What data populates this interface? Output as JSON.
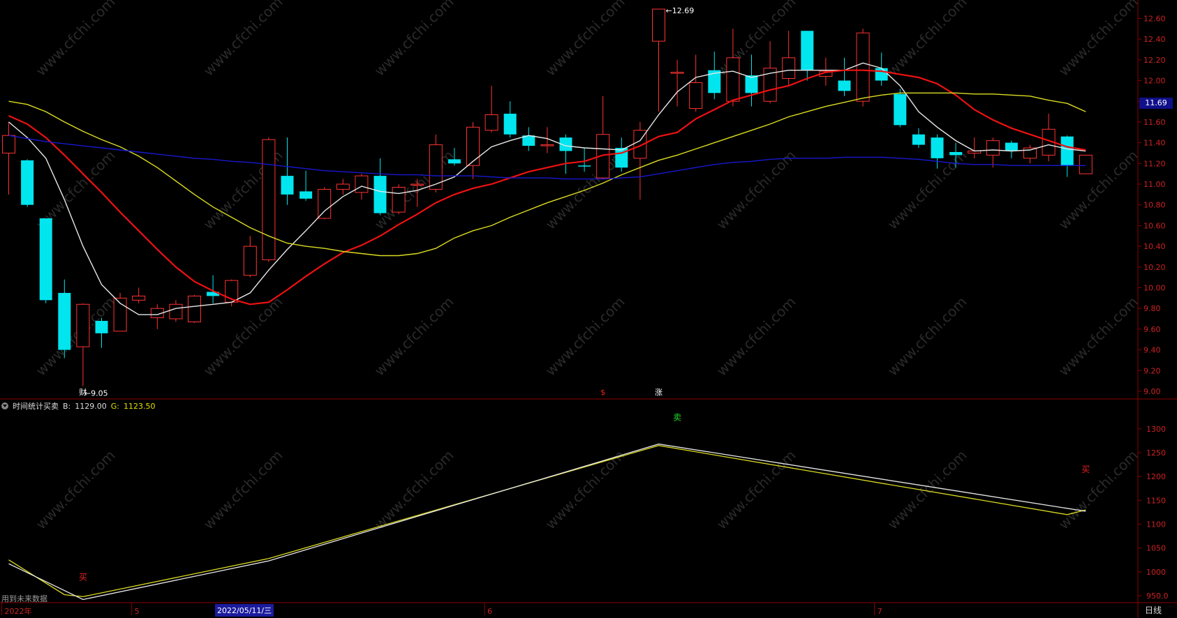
{
  "chart_data": {
    "type": "candlestick",
    "price_axis": {
      "ticks": [
        "9.00",
        "9.20",
        "9.40",
        "9.60",
        "9.80",
        "10.00",
        "10.20",
        "10.40",
        "10.60",
        "10.80",
        "11.00",
        "11.20",
        "11.40",
        "11.60",
        "11.80",
        "12.00",
        "12.20",
        "12.40",
        "12.60"
      ],
      "ylim": [
        8.93,
        12.78
      ]
    },
    "candles": [
      [
        11.3,
        11.47,
        11.6,
        10.9
      ],
      [
        11.23,
        10.8,
        11.24,
        10.78
      ],
      [
        10.67,
        9.88,
        10.67,
        9.85
      ],
      [
        9.95,
        9.4,
        10.08,
        9.32
      ],
      [
        9.43,
        9.84,
        9.85,
        9.05
      ],
      [
        9.68,
        9.56,
        9.71,
        9.42
      ],
      [
        9.58,
        9.9,
        9.95,
        9.58
      ],
      [
        9.88,
        9.92,
        10.0,
        9.85
      ],
      [
        9.71,
        9.8,
        9.84,
        9.6
      ],
      [
        9.7,
        9.84,
        9.88,
        9.67
      ],
      [
        9.67,
        9.92,
        9.93,
        9.66
      ],
      [
        9.96,
        9.92,
        10.12,
        9.85
      ],
      [
        9.86,
        10.07,
        10.08,
        9.82
      ],
      [
        10.12,
        10.4,
        10.5,
        10.1
      ],
      [
        10.27,
        11.43,
        11.45,
        10.25
      ],
      [
        11.08,
        10.9,
        11.45,
        10.8
      ],
      [
        10.93,
        10.86,
        11.13,
        10.84
      ],
      [
        10.67,
        10.95,
        10.97,
        10.66
      ],
      [
        10.95,
        11.0,
        11.05,
        10.9
      ],
      [
        10.92,
        11.08,
        11.1,
        10.85
      ],
      [
        11.08,
        10.72,
        11.25,
        10.7
      ],
      [
        10.73,
        10.97,
        11.0,
        10.71
      ],
      [
        11.0,
        11.0,
        11.05,
        10.78
      ],
      [
        10.95,
        11.38,
        11.48,
        10.92
      ],
      [
        11.24,
        11.2,
        11.35,
        11.18
      ],
      [
        11.18,
        11.55,
        11.6,
        11.05
      ],
      [
        11.52,
        11.67,
        11.95,
        11.5
      ],
      [
        11.68,
        11.48,
        11.8,
        11.45
      ],
      [
        11.47,
        11.37,
        11.55,
        11.32
      ],
      [
        11.38,
        11.38,
        11.55,
        11.3
      ],
      [
        11.45,
        11.32,
        11.48,
        11.1
      ],
      [
        11.18,
        11.17,
        11.35,
        11.12
      ],
      [
        11.06,
        11.48,
        11.85,
        11.05
      ],
      [
        11.35,
        11.16,
        11.45,
        11.12
      ],
      [
        11.25,
        11.52,
        11.6,
        10.85
      ],
      [
        12.38,
        12.69,
        12.69,
        11.7
      ],
      [
        12.08,
        12.08,
        12.2,
        11.75
      ],
      [
        11.73,
        11.98,
        12.25,
        11.7
      ],
      [
        12.1,
        11.88,
        12.28,
        11.82
      ],
      [
        11.8,
        12.22,
        12.5,
        11.75
      ],
      [
        12.05,
        11.88,
        12.25,
        11.75
      ],
      [
        11.8,
        12.12,
        12.38,
        11.78
      ],
      [
        12.02,
        12.22,
        12.48,
        11.95
      ],
      [
        12.48,
        12.1,
        12.48,
        12.0
      ],
      [
        12.04,
        12.09,
        12.22,
        11.95
      ],
      [
        12.0,
        11.9,
        12.22,
        11.85
      ],
      [
        11.8,
        12.46,
        12.5,
        11.75
      ],
      [
        12.12,
        12.0,
        12.27,
        11.95
      ],
      [
        11.87,
        11.57,
        11.92,
        11.55
      ],
      [
        11.48,
        11.38,
        11.54,
        11.35
      ],
      [
        11.45,
        11.25,
        11.48,
        11.15
      ],
      [
        11.31,
        11.28,
        11.4,
        11.16
      ],
      [
        11.3,
        11.32,
        11.45,
        11.25
      ],
      [
        11.28,
        11.42,
        11.45,
        11.16
      ],
      [
        11.4,
        11.32,
        11.42,
        11.25
      ],
      [
        11.25,
        11.35,
        11.38,
        11.2
      ],
      [
        11.28,
        11.53,
        11.68,
        11.22
      ],
      [
        11.46,
        11.18,
        11.47,
        11.07
      ],
      [
        11.1,
        11.28,
        11.28,
        11.1
      ]
    ],
    "ma_lines": [
      {
        "color": "#e8e8e8",
        "values": [
          11.6,
          11.45,
          11.25,
          10.85,
          10.4,
          10.03,
          9.85,
          9.74,
          9.74,
          9.8,
          9.82,
          9.84,
          9.86,
          9.95,
          10.17,
          10.37,
          10.55,
          10.74,
          10.88,
          10.98,
          10.93,
          10.91,
          10.94,
          11.0,
          11.07,
          11.22,
          11.36,
          11.42,
          11.47,
          11.44,
          11.37,
          11.35,
          11.34,
          11.33,
          11.42,
          11.67,
          11.89,
          12.03,
          12.07,
          12.09,
          12.03,
          12.07,
          12.1,
          12.1,
          12.1,
          12.1,
          12.17,
          12.12,
          11.95,
          11.7,
          11.55,
          11.42,
          11.32,
          11.33,
          11.32,
          11.33,
          11.38,
          11.34,
          11.32
        ]
      },
      {
        "color": "#ee1111",
        "values": [
          11.66,
          11.58,
          11.45,
          11.28,
          11.1,
          10.92,
          10.73,
          10.55,
          10.37,
          10.2,
          10.06,
          9.97,
          9.89,
          9.84,
          9.86,
          9.98,
          10.11,
          10.23,
          10.34,
          10.41,
          10.5,
          10.61,
          10.71,
          10.82,
          10.9,
          10.96,
          11.0,
          11.06,
          11.12,
          11.16,
          11.2,
          11.22,
          11.28,
          11.3,
          11.37,
          11.46,
          11.5,
          11.63,
          11.72,
          11.81,
          11.86,
          11.91,
          11.95,
          12.02,
          12.08,
          12.1,
          12.1,
          12.09,
          12.06,
          12.03,
          11.97,
          11.86,
          11.72,
          11.62,
          11.54,
          11.48,
          11.42,
          11.36,
          11.33
        ]
      },
      {
        "color": "#dcdc22",
        "values": [
          11.8,
          11.77,
          11.7,
          11.6,
          11.51,
          11.43,
          11.36,
          11.27,
          11.16,
          11.03,
          10.9,
          10.78,
          10.68,
          10.58,
          10.5,
          10.43,
          10.4,
          10.38,
          10.35,
          10.33,
          10.31,
          10.31,
          10.33,
          10.38,
          10.48,
          10.55,
          10.6,
          10.68,
          10.75,
          10.82,
          10.88,
          10.94,
          11.01,
          11.09,
          11.16,
          11.23,
          11.28,
          11.34,
          11.4,
          11.46,
          11.52,
          11.58,
          11.65,
          11.7,
          11.75,
          11.79,
          11.83,
          11.86,
          11.88,
          11.88,
          11.88,
          11.88,
          11.87,
          11.87,
          11.86,
          11.85,
          11.81,
          11.78,
          11.7
        ]
      },
      {
        "color": "#1818d0",
        "values": [
          11.47,
          11.44,
          11.41,
          11.39,
          11.37,
          11.35,
          11.33,
          11.31,
          11.29,
          11.27,
          11.25,
          11.24,
          11.22,
          11.21,
          11.19,
          11.17,
          11.15,
          11.13,
          11.12,
          11.11,
          11.1,
          11.09,
          11.09,
          11.08,
          11.08,
          11.08,
          11.07,
          11.06,
          11.06,
          11.06,
          11.05,
          11.05,
          11.05,
          11.06,
          11.07,
          11.1,
          11.13,
          11.16,
          11.19,
          11.21,
          11.22,
          11.24,
          11.25,
          11.25,
          11.25,
          11.26,
          11.26,
          11.26,
          11.25,
          11.24,
          11.22,
          11.2,
          11.19,
          11.19,
          11.18,
          11.18,
          11.18,
          11.18,
          11.18
        ]
      }
    ],
    "price_annotations": [
      {
        "text": "12.69",
        "candle": 35,
        "price": 12.69
      },
      {
        "text": "9.05",
        "candle": 4,
        "price": 9.05
      },
      {
        "text": "11.69",
        "note": "current price box"
      }
    ],
    "markers": [
      {
        "text": "财",
        "candle": 4,
        "color": "#ffffff"
      },
      {
        "text": "$",
        "candle": 32,
        "color": "#ee2222"
      },
      {
        "text": "涨",
        "candle": 35,
        "color": "#ffffff"
      }
    ],
    "indicator": {
      "name": "时间统计买卖",
      "b_label": "B:",
      "b_value": "1129.00",
      "g_label": "G:",
      "g_value": "1123.50",
      "ticks": [
        "950.0",
        "1000",
        "1050",
        "1100",
        "1150",
        "1200",
        "1250",
        "1300"
      ],
      "ylim": [
        942,
        1335
      ],
      "b_line": [
        [
          0,
          1017
        ],
        [
          4,
          942
        ],
        [
          14,
          1023
        ],
        [
          35,
          1268
        ],
        [
          58,
          1127
        ]
      ],
      "g_line": [
        [
          0,
          1025
        ],
        [
          3,
          952
        ],
        [
          4,
          948
        ],
        [
          14,
          1028
        ],
        [
          35,
          1265
        ],
        [
          57,
          1120
        ],
        [
          58,
          1130
        ]
      ],
      "signals": [
        {
          "text": "买",
          "candle": 4,
          "value": 983,
          "color": "#ee2222"
        },
        {
          "text": "卖",
          "candle": 36,
          "value": 1318,
          "color": "#22dd22"
        },
        {
          "text": "买",
          "candle": 58,
          "value": 1209,
          "color": "#ee2222"
        }
      ]
    },
    "date_axis": [
      {
        "text": "2022年",
        "candle": 0
      },
      {
        "text": "5",
        "candle": 7
      },
      {
        "text": "6",
        "candle": 26
      },
      {
        "text": "7",
        "candle": 47
      }
    ],
    "highlight_date": "2022/05/11/三",
    "watermark": "www.cfchi.com"
  },
  "ui": {
    "note": "用到未来数据",
    "period": "日线"
  },
  "colors": {
    "up": "#ff3333",
    "down": "#00e5ee",
    "grid": "#8b0000",
    "axis_text": "#cc2222"
  }
}
